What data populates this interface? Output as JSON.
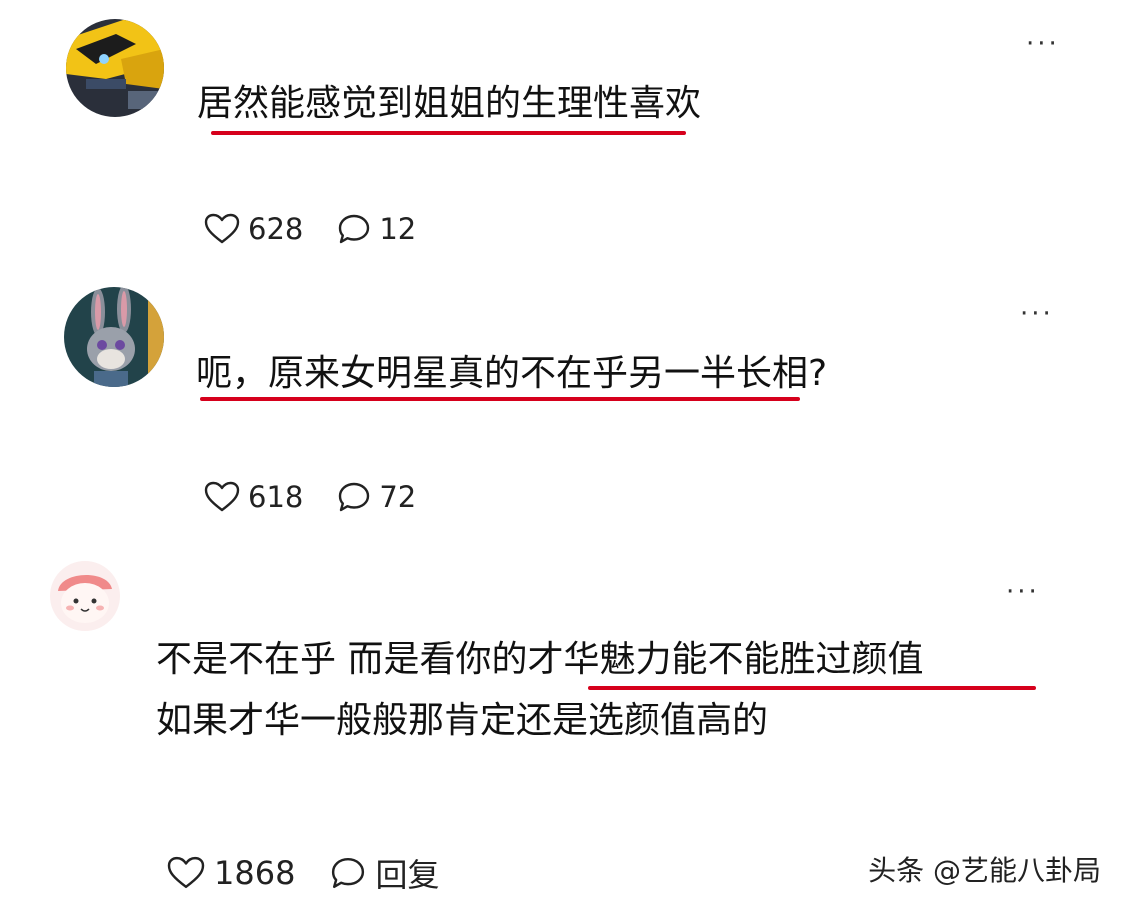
{
  "comments": [
    {
      "line1": "居然能感觉到姐姐的生理性喜欢",
      "likes": "628",
      "replies": "12",
      "more": "···",
      "avatar": "bumblebee-avatar"
    },
    {
      "line1": "呃，原来女明星真的不在乎另一半长相?",
      "likes": "618",
      "replies": "72",
      "more": "···",
      "avatar": "rabbit-avatar"
    },
    {
      "line1": "不是不在乎 而是看你的才华魅力能不能胜过颜值",
      "line2": "如果才华一般般那肯定还是选颜值高的",
      "likes": "1868",
      "replies": "回复",
      "more": "···",
      "avatar": "cartoon-avatar"
    }
  ],
  "watermark": "头条 @艺能八卦局",
  "colors": {
    "underline": "#d6001c",
    "text": "#111111"
  }
}
